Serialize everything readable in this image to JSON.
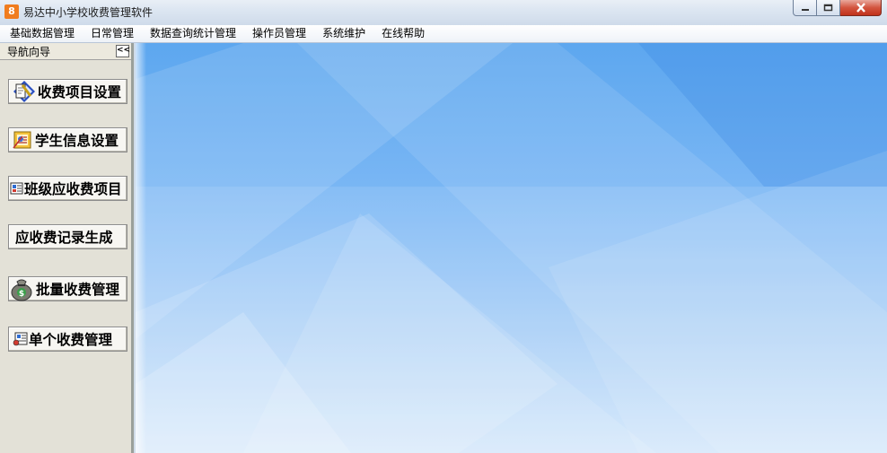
{
  "window": {
    "title": "易达中小学校收费管理软件",
    "app_icon_glyph": "8"
  },
  "menubar": {
    "items": [
      "基础数据管理",
      "日常管理",
      "数据查询统计管理",
      "操作员管理",
      "系统维护",
      "在线帮助"
    ]
  },
  "nav": {
    "title": "导航向导",
    "collapse_glyph": "<<",
    "buttons": [
      {
        "label": "收费项目设置",
        "icon": "fee-item-settings-icon"
      },
      {
        "label": "学生信息设置",
        "icon": "student-info-icon"
      },
      {
        "label": "班级应收费项目",
        "icon": "class-fee-items-icon"
      },
      {
        "label": "应收费记录生成",
        "icon": ""
      },
      {
        "label": "批量收费管理",
        "icon": "money-bag-icon"
      },
      {
        "label": "单个收费管理",
        "icon": "single-fee-icon"
      }
    ]
  },
  "colors": {
    "accent_blue": "#5da7ef",
    "close_red": "#c0321b",
    "app_icon_orange": "#f07c1e",
    "nav_bg": "#e3e1d7"
  }
}
